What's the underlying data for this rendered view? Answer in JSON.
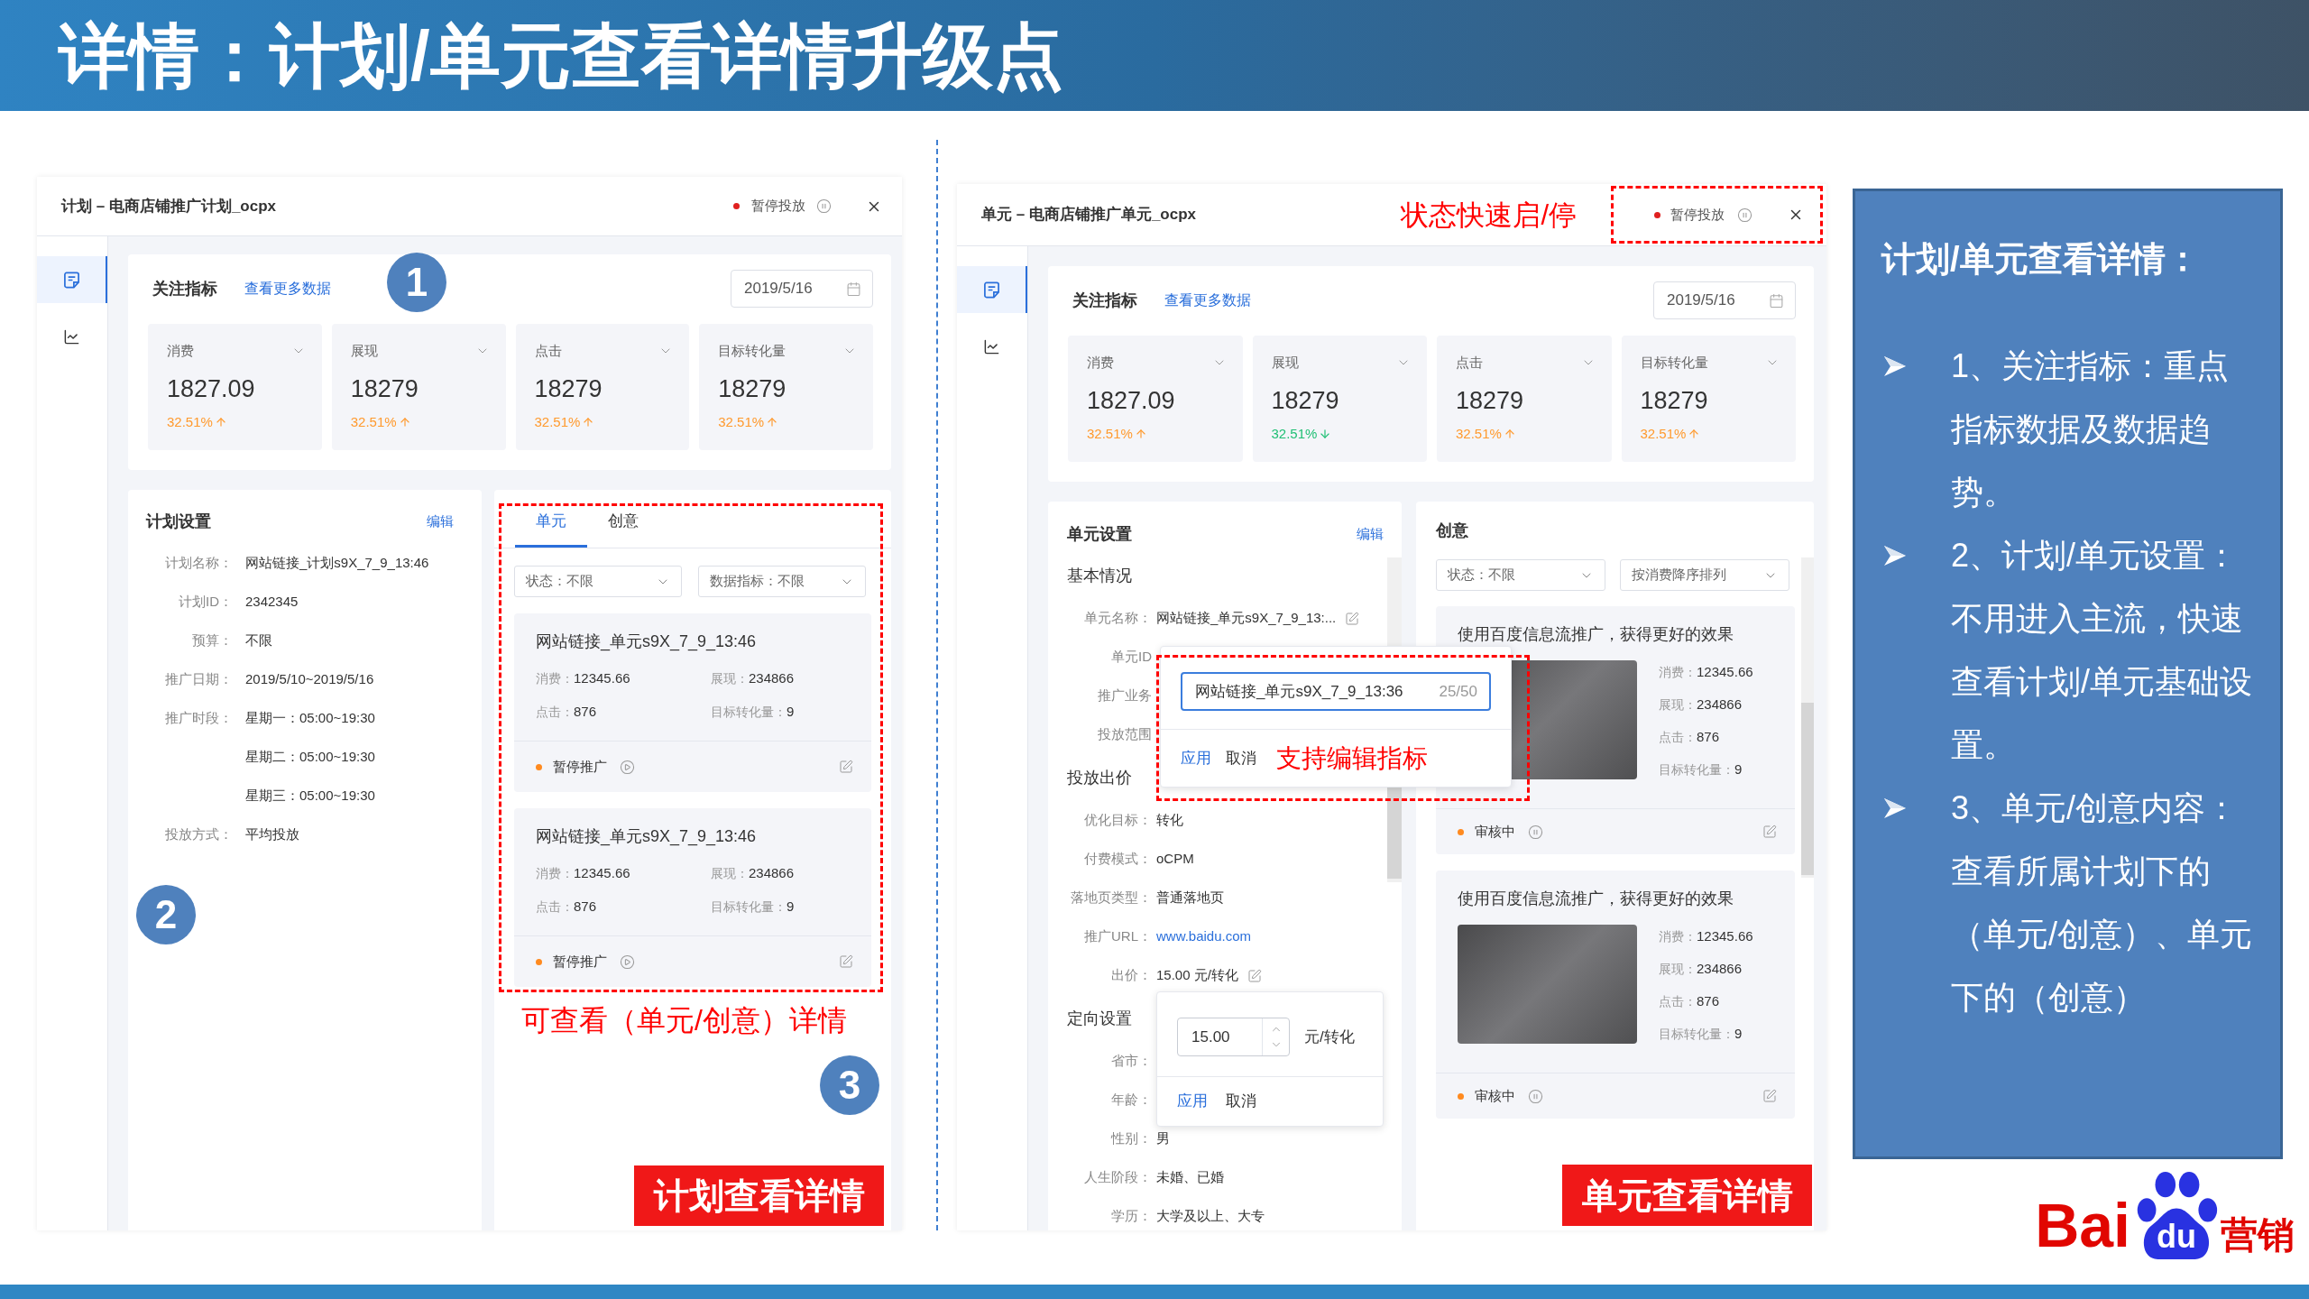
{
  "title": "详情：计划/单元查看详情升级点",
  "plan_panel": {
    "header": {
      "title": "计划 – 电商店铺推广计划_ocpx",
      "status": {
        "label": "暂停投放",
        "color": "#e0201f"
      }
    },
    "nav": [
      {
        "selected": true
      },
      {
        "selected": false
      }
    ],
    "metrics": {
      "title": "关注指标",
      "link": "查看更多数据",
      "date": "2019/5/16",
      "step": "1",
      "tiles": [
        {
          "label": "消费",
          "value": "1827.09",
          "change": "32.51%",
          "rising": true
        },
        {
          "label": "展现",
          "value": "18279",
          "change": "32.51%",
          "rising": true
        },
        {
          "label": "点击",
          "value": "18279",
          "change": "32.51%",
          "rising": true
        },
        {
          "label": "目标转化量",
          "value": "18279",
          "change": "32.51%",
          "rising": true
        }
      ]
    },
    "settings": {
      "title": "计划设置",
      "action": "编辑",
      "step": "2",
      "rows": [
        {
          "label": "计划名称：",
          "value": "网站链接_计划s9X_7_9_13:46"
        },
        {
          "label": "计划ID：",
          "value": "2342345"
        },
        {
          "label": "预算：",
          "value": "不限"
        },
        {
          "label": "推广日期：",
          "value": "2019/5/10~2019/5/16"
        },
        {
          "label": "推广时段：",
          "value": "星期一：05:00~19:30"
        },
        {
          "value": "星期二：05:00~19:30"
        },
        {
          "value": "星期三：05:00~19:30"
        },
        {
          "label": "投放方式：",
          "value": "平均投放"
        }
      ]
    },
    "units": {
      "tabs": [
        {
          "label": "单元",
          "selected": true
        },
        {
          "label": "创意",
          "selected": false
        }
      ],
      "filters": [
        "状态：不限",
        "数据指标：不限"
      ],
      "items": [
        {
          "title": "网站链接_单元s9X_7_9_13:46",
          "stats": [
            {
              "label": "消费：",
              "value": "12345.66"
            },
            {
              "label": "展现：",
              "value": "234866"
            },
            {
              "label": "点击：",
              "value": "876"
            },
            {
              "label": "目标转化量：",
              "value": "9"
            }
          ],
          "status": {
            "label": "暂停推广",
            "color": "#ff8a1f",
            "paused": true
          }
        },
        {
          "title": "网站链接_单元s9X_7_9_13:46",
          "stats": [
            {
              "label": "消费：",
              "value": "12345.66"
            },
            {
              "label": "展现：",
              "value": "234866"
            },
            {
              "label": "点击：",
              "value": "876"
            },
            {
              "label": "目标转化量：",
              "value": "9"
            }
          ],
          "status": {
            "label": "暂停推广",
            "color": "#ff8a1f",
            "paused": true
          }
        }
      ],
      "note": "可查看（单元/创意）详情",
      "step": "3"
    },
    "tag": "计划查看详情"
  },
  "unit_panel": {
    "header": {
      "title": "单元 – 电商店铺推广单元_ocpx",
      "note": "状态快速启/停",
      "status": {
        "label": "暂停投放",
        "color": "#e0201f"
      }
    },
    "nav": [
      {
        "selected": true
      },
      {
        "selected": false
      }
    ],
    "metrics": {
      "title": "关注指标",
      "link": "查看更多数据",
      "date": "2019/5/16",
      "tiles": [
        {
          "label": "消费",
          "value": "1827.09",
          "change": "32.51%",
          "rising": true
        },
        {
          "label": "展现",
          "value": "18279",
          "change": "32.51%",
          "rising": false
        },
        {
          "label": "点击",
          "value": "18279",
          "change": "32.51%",
          "rising": true
        },
        {
          "label": "目标转化量",
          "value": "18279",
          "change": "32.51%",
          "rising": true
        }
      ]
    },
    "settings": {
      "title": "单元设置",
      "action": "编辑",
      "sections": [
        {
          "heading": "基本情况",
          "rows": [
            {
              "kind": "editable",
              "label": "单元名称：",
              "value": "网站链接_单元s9X_7_9_13:..."
            },
            {
              "kind": "text",
              "label": "单元ID"
            },
            {
              "kind": "text",
              "label": "推广业务"
            },
            {
              "kind": "text",
              "label": "投放范围"
            }
          ]
        },
        {
          "heading": "投放出价",
          "rows": [
            {
              "kind": "text",
              "label": "优化目标：",
              "value": "转化"
            },
            {
              "kind": "text",
              "label": "付费模式：",
              "value": "oCPM"
            },
            {
              "kind": "text",
              "label": "落地页类型：",
              "value": "普通落地页"
            },
            {
              "kind": "link",
              "label": "推广URL：",
              "value": "www.baidu.com"
            },
            {
              "kind": "editable",
              "label": "出价：",
              "value": "15.00 元/转化"
            }
          ]
        },
        {
          "heading": "定向设置",
          "rows": [
            {
              "kind": "text",
              "label": "省市："
            },
            {
              "kind": "text",
              "label": "年龄："
            },
            {
              "kind": "text",
              "label": "性别：",
              "value": "男"
            },
            {
              "kind": "text",
              "label": "人生阶段：",
              "value": "未婚、已婚"
            },
            {
              "kind": "text",
              "label": "学历：",
              "value": "大学及以上、大专"
            }
          ]
        }
      ]
    },
    "name_editor": {
      "value": "网站链接_单元s9X_7_9_13:36",
      "counter": "25/50",
      "apply": "应用",
      "cancel": "取消",
      "note": "支持编辑指标"
    },
    "bid_editor": {
      "value": "15.00",
      "unit": "元/转化",
      "apply": "应用",
      "cancel": "取消"
    },
    "creatives": {
      "title": "创意",
      "filters": [
        "状态：不限",
        "按消费降序排列"
      ],
      "items": [
        {
          "title": "使用百度信息流推广，获得更好的效果",
          "stats": [
            {
              "label": "消费：",
              "value": "12345.66"
            },
            {
              "label": "展现：",
              "value": "234866"
            },
            {
              "label": "点击：",
              "value": "876"
            },
            {
              "label": "目标转化量：",
              "value": "9"
            }
          ],
          "status": {
            "label": "审核中",
            "color": "#ff8a1f",
            "paused": false
          }
        },
        {
          "title": "使用百度信息流推广，获得更好的效果",
          "stats": [
            {
              "label": "消费：",
              "value": "12345.66"
            },
            {
              "label": "展现：",
              "value": "234866"
            },
            {
              "label": "点击：",
              "value": "876"
            },
            {
              "label": "目标转化量：",
              "value": "9"
            }
          ],
          "status": {
            "label": "审核中",
            "color": "#ff8a1f",
            "paused": false
          }
        }
      ]
    },
    "tag": "单元查看详情"
  },
  "notes": {
    "title": "计划/单元查看详情：",
    "bullets": [
      "1、关注指标：重点指标数据及数据趋势。",
      "2、计划/单元设置：不用进入主流，快速查看计划/单元基础设置。",
      "3、单元/创意内容：查看所属计划下的（单元/创意）、单元下的（创意）"
    ]
  },
  "logo": {
    "left": "Bai",
    "mark": "du",
    "right": "营销"
  }
}
